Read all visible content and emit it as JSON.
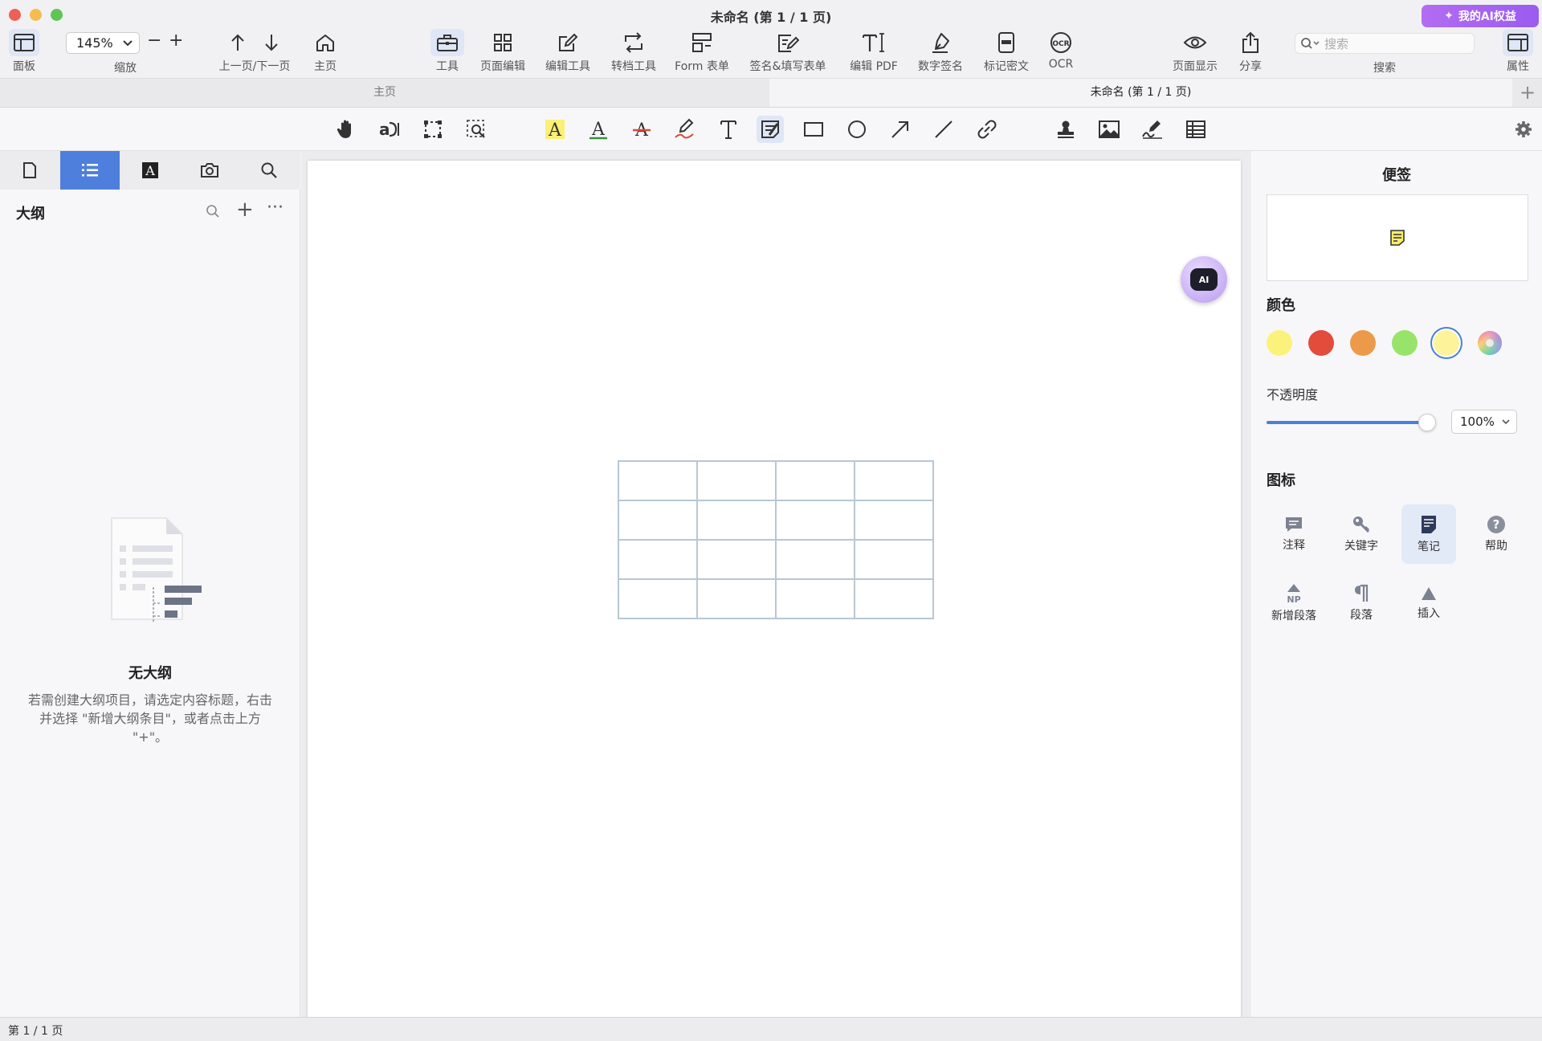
{
  "window": {
    "title": "未命名 (第 1 / 1 页)",
    "ai_badge": "我的AI权益"
  },
  "toolbar": {
    "panel": "面板",
    "zoom_value": "145%",
    "zoom_label": "缩放",
    "zoom_minus": "−",
    "zoom_plus": "+",
    "prev_next": "上一页/下一页",
    "home": "主页",
    "tools": "工具",
    "page_edit": "页面编辑",
    "edit_tools": "编辑工具",
    "convert_tools": "转档工具",
    "form": "Form 表单",
    "sign_fill": "签名&填写表单",
    "edit_pdf": "编辑 PDF",
    "digital_sign": "数字签名",
    "redact": "标记密文",
    "ocr": "OCR",
    "page_display": "页面显示",
    "share": "分享",
    "search_placeholder": "搜索",
    "search_label": "搜索",
    "properties": "属性"
  },
  "tabs": {
    "home": "主页",
    "document": "未命名 (第 1 / 1 页)",
    "add": "+"
  },
  "sidebar": {
    "outline_title": "大纲",
    "add": "+",
    "more": "···",
    "empty_title": "无大纲",
    "empty_desc": "若需创建大纲项目，请选定内容标题，右击并选择 \"新增大纲条目\"，或者点击上方 \"+\"。"
  },
  "right_panel": {
    "title": "便签",
    "color_heading": "颜色",
    "colors": [
      "#fbf27c",
      "#e34b3a",
      "#ec9a4a",
      "#98e46a",
      "#fdf39a"
    ],
    "opacity_label": "不透明度",
    "opacity_value": "100%",
    "opacity": 1.0,
    "icon_heading": "图标",
    "icons": [
      "注释",
      "关键字",
      "笔记",
      "帮助",
      "新增段落",
      "段落",
      "插入"
    ]
  },
  "status": {
    "page": "第 1 / 1 页"
  },
  "accent_color": "#4f7fdc"
}
